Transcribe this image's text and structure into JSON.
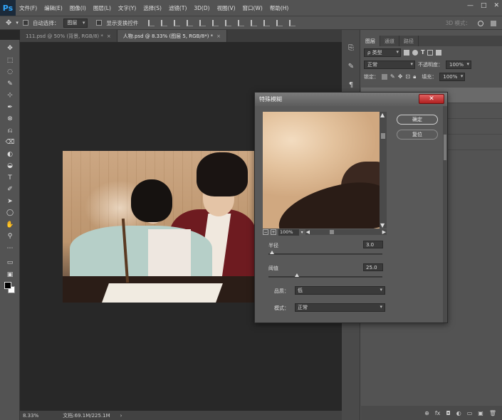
{
  "app": {
    "logo": "Ps"
  },
  "menu": [
    "文件(F)",
    "编辑(E)",
    "图像(I)",
    "图层(L)",
    "文字(Y)",
    "选择(S)",
    "滤镜(T)",
    "3D(D)",
    "视图(V)",
    "窗口(W)",
    "帮助(H)"
  ],
  "window_controls": {
    "minimize": "—",
    "maximize": "□",
    "close": "✕"
  },
  "options": {
    "move_icon": "✥",
    "auto_select_label": "自动选择：",
    "auto_select_value": "图层",
    "show_transform_label": "显示变换控件",
    "mode_3d": "3D 模式："
  },
  "tabs": [
    {
      "label": "111.psd @ 50% (背景, RGB/8) *",
      "close": "×"
    },
    {
      "label": "人物.psd @ 8.33% (图层 5, RGB/8*) *",
      "close": "×"
    }
  ],
  "tools": [
    "✥",
    "⬚",
    "◌",
    "✎",
    "⊹",
    "✒",
    "⊗",
    "⎌",
    "⌫",
    "◐",
    "◒",
    "T",
    "✐",
    "➤",
    "◯",
    "✋",
    "⚲",
    "⋯"
  ],
  "layers_panel": {
    "tabs": [
      "图层",
      "通道",
      "路径"
    ],
    "filter_kind": "ρ 类型",
    "blend_mode": "正常",
    "opacity_label": "不透明度：",
    "opacity_value": "100%",
    "lock_label": "锁定：",
    "fill_label": "填充：",
    "fill_value": "100%",
    "bottom_icons": [
      "⊕",
      "fx",
      "◘",
      "◐",
      "▭",
      "▣",
      "🗑"
    ]
  },
  "status": {
    "zoom": "8.33%",
    "doc": "文档:69.1M/225.1M",
    "arrow": "›"
  },
  "dialog": {
    "title": "特殊模糊",
    "close": "✕",
    "ok": "确定",
    "reset": "复位",
    "preview_zoom": "100%",
    "zoom_out": "−",
    "zoom_in": "+",
    "radius_label": "半径",
    "radius_value": "3.0",
    "threshold_label": "阈值",
    "threshold_value": "25.0",
    "quality_label": "品质：",
    "quality_value": "低",
    "mode_label": "模式：",
    "mode_value": "正常",
    "radius": 3.0,
    "radius_max": 100,
    "threshold": 25.0,
    "threshold_max": 100
  }
}
